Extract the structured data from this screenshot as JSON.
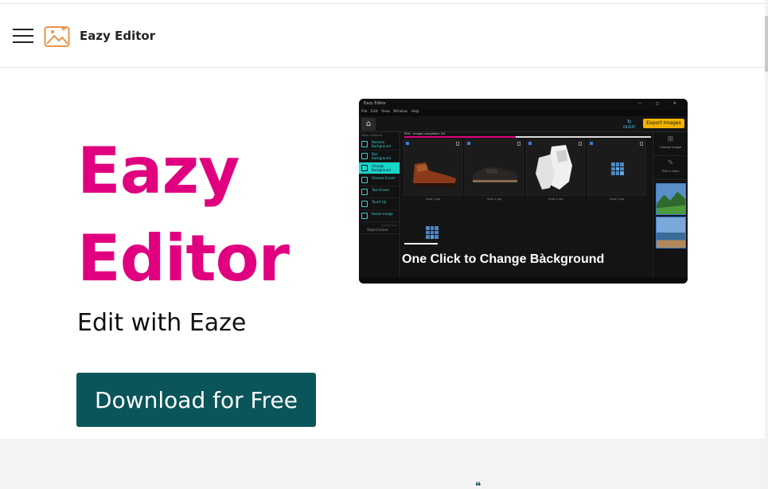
{
  "brand": {
    "name": "Eazy Editor"
  },
  "hero": {
    "title_line1": "Eazy",
    "title_line2": "Editor",
    "tagline": "Edit with Eaze",
    "cta_label": "Download for Free"
  },
  "colors": {
    "accent": "#e0007f",
    "cta": "#0a5559",
    "app_highlight": "#18d6c8",
    "export": "#f0b400"
  },
  "icons": {
    "menu": "hamburger-icon",
    "logo": "image-sparkle-icon"
  },
  "app_preview": {
    "window_title": "Eazy Editor",
    "window_controls": "— ◻ ✕",
    "menu": "File Edit View Window Help",
    "revert_label": "REVERT",
    "export_label": "Export Images",
    "magic_label": "Magic Products",
    "progress_label": "60% · Images completed: 3/5",
    "progress_value": 0.45,
    "tools": [
      {
        "label": "Remove Background"
      },
      {
        "label": "Blur Background"
      },
      {
        "label": "Change Background",
        "active": true
      },
      {
        "label": "Shadow Eraser"
      },
      {
        "label": "Text Eraser"
      },
      {
        "label": "Touch Up"
      },
      {
        "label": "Resize Image"
      }
    ],
    "object_eraser_label": "Object Eraser",
    "coming_soon": "Coming Soon",
    "files": [
      "shoe-1.jpg",
      "shoe-2.jpg",
      "shoe-4.jpg",
      "shoe-5.jpg"
    ],
    "right_tools": [
      "Choose Image",
      "Pick a color"
    ],
    "caption": "One Click to Change Bàckground"
  }
}
